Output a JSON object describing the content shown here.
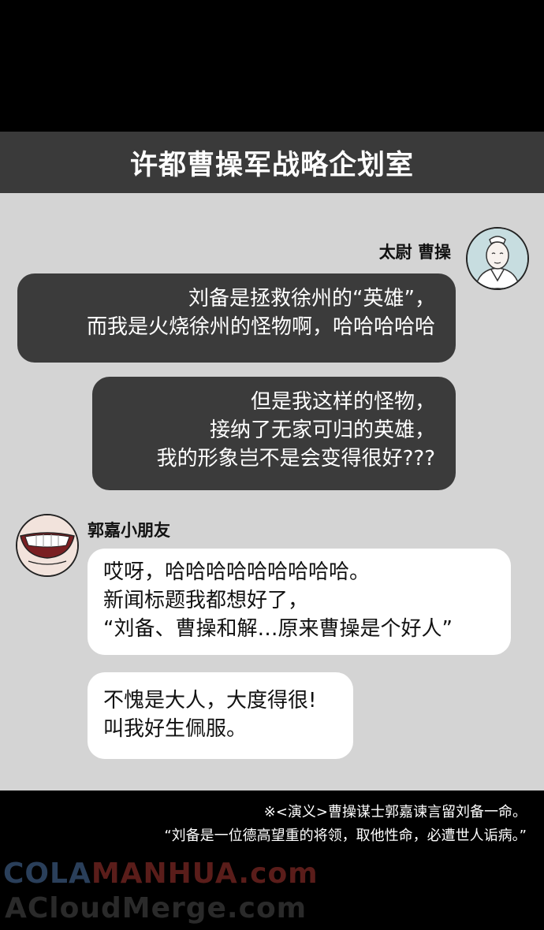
{
  "title": "许都曹操军战略企划室",
  "speakers": {
    "caocao": {
      "name": "太尉 曹操",
      "icon": "caocao-portrait-icon"
    },
    "guojia": {
      "name": "郭嘉小朋友",
      "icon": "smiling-mouth-icon"
    }
  },
  "messages": [
    {
      "sender": "caocao",
      "lines": [
        "刘备是拯救徐州的“英雄”，",
        "而我是火烧徐州的怪物啊，哈哈哈哈哈"
      ]
    },
    {
      "sender": "caocao",
      "lines": [
        "但是我这样的怪物，",
        "接纳了无家可归的英雄，",
        "我的形象岂不是会变得很好???"
      ]
    },
    {
      "sender": "guojia",
      "lines": [
        "哎呀，哈哈哈哈哈哈哈哈哈。",
        "新闻标题我都想好了，",
        "“刘备、曹操和解…原来曹操是个好人”"
      ]
    },
    {
      "sender": "guojia",
      "lines": [
        "不愧是大人，大度得很!",
        "叫我好生佩服。"
      ]
    }
  ],
  "footnote": {
    "line1": "※<演义>曹操谋士郭嘉谏言留刘备一命。",
    "line2": "“刘备是一位德高望重的将领，取他性命，必遭世人诟病。”"
  },
  "watermark": {
    "part1": "COLA",
    "part2": "MANHUA.com",
    "line2": "ACloudMerge.com"
  },
  "colors": {
    "title_bar": "#3a3a3a",
    "chat_background": "#d4d4d4",
    "dark_bubble": "#3b3b3b",
    "light_bubble": "#ffffff"
  }
}
